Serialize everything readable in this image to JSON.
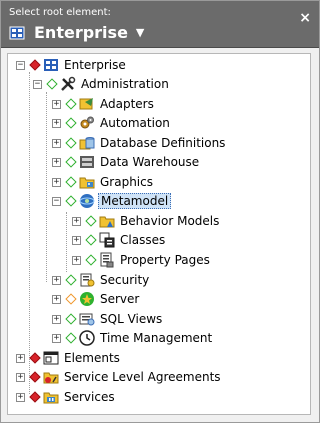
{
  "header": {
    "label": "Select root element:",
    "root_name": "Enterprise",
    "close_symbol": "×"
  },
  "tree": {
    "root": "Enterprise",
    "administration": "Administration",
    "adapters": "Adapters",
    "automation": "Automation",
    "database_definitions": "Database Definitions",
    "data_warehouse": "Data Warehouse",
    "graphics": "Graphics",
    "metamodel": "Metamodel",
    "behavior_models": "Behavior Models",
    "classes": "Classes",
    "property_pages": "Property Pages",
    "security": "Security",
    "server": "Server",
    "sql_views": "SQL Views",
    "time_management": "Time Management",
    "elements": "Elements",
    "service_level_agreements": "Service Level Agreements",
    "services": "Services",
    "expand_symbol": "+",
    "collapse_symbol": "−"
  },
  "colors": {
    "header_bg": "#6b6b6b",
    "status_red": "#d8232a",
    "status_green": "#2fb12f",
    "status_orange": "#f0962b",
    "selection": "#cfe3f7"
  }
}
